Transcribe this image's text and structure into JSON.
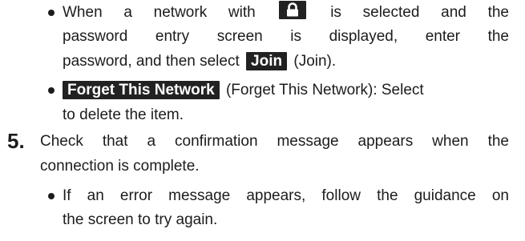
{
  "bullet1": {
    "line1_a": "When a network with",
    "line1_b": "is selected and the",
    "line2": "password entry screen is displayed, enter the",
    "line3_a": "password, and then select",
    "join_button": "Join",
    "line3_b": "(Join)."
  },
  "bullet2": {
    "forget_button": "Forget This Network",
    "line1_b": "(Forget This Network): Select",
    "line2": "to delete the item."
  },
  "step5": {
    "number": "5.",
    "line1": "Check that a confirmation message appears when the",
    "line2": "connection is complete."
  },
  "bullet3": {
    "line1": "If an error message appears, follow the guidance on",
    "line2": "the screen to try again."
  }
}
